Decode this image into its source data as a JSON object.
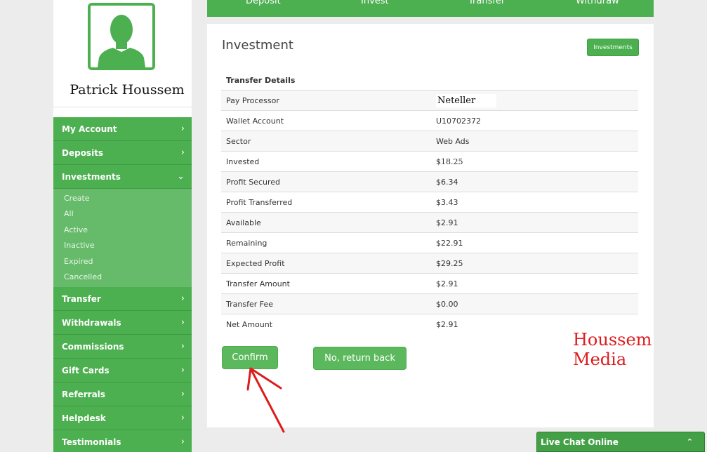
{
  "user": {
    "name": "Patrick Houssem"
  },
  "colors": {
    "brand_green": "#4caf50",
    "submenu_green": "#66bb6a",
    "watermark_red": "#dd1c1c"
  },
  "top_tabs": [
    "Deposit",
    "Invest",
    "Transfer",
    "Withdraw"
  ],
  "sidebar": {
    "items": [
      {
        "label": "My Account",
        "chevron": "›"
      },
      {
        "label": "Deposits",
        "chevron": "›"
      },
      {
        "label": "Investments",
        "chevron": "⌄"
      },
      {
        "label": "Transfer",
        "chevron": "›"
      },
      {
        "label": "Withdrawals",
        "chevron": "›"
      },
      {
        "label": "Commissions",
        "chevron": "›"
      },
      {
        "label": "Gift Cards",
        "chevron": "›"
      },
      {
        "label": "Referrals",
        "chevron": "›"
      },
      {
        "label": "Helpdesk",
        "chevron": "›"
      },
      {
        "label": "Testimonials",
        "chevron": "›"
      }
    ],
    "submenu": [
      "Create",
      "All",
      "Active",
      "Inactive",
      "Expired",
      "Cancelled"
    ]
  },
  "main": {
    "title": "Investment",
    "investments_button": "Investments",
    "table": {
      "heading": "Transfer Details",
      "rows": [
        {
          "label": "Pay Processor",
          "value": "Neteller"
        },
        {
          "label": "Wallet Account",
          "value": "U10702372"
        },
        {
          "label": "Sector",
          "value": "Web Ads"
        },
        {
          "label": "Invested",
          "value": "$18.25"
        },
        {
          "label": "Profit Secured",
          "value": "$6.34"
        },
        {
          "label": "Profit Transferred",
          "value": "$3.43"
        },
        {
          "label": "Available",
          "value": "$2.91"
        },
        {
          "label": "Remaining",
          "value": "$22.91"
        },
        {
          "label": "Expected Profit",
          "value": "$29.25"
        },
        {
          "label": "Transfer Amount",
          "value": "$2.91"
        },
        {
          "label": "Transfer Fee",
          "value": "$0.00"
        },
        {
          "label": "Net Amount",
          "value": "$2.91"
        }
      ]
    },
    "confirm_label": "Confirm",
    "return_label": "No, return back"
  },
  "watermark": "Houssem Media",
  "live_chat": {
    "label": "Live Chat Online",
    "icon": "chevron-up-icon"
  }
}
